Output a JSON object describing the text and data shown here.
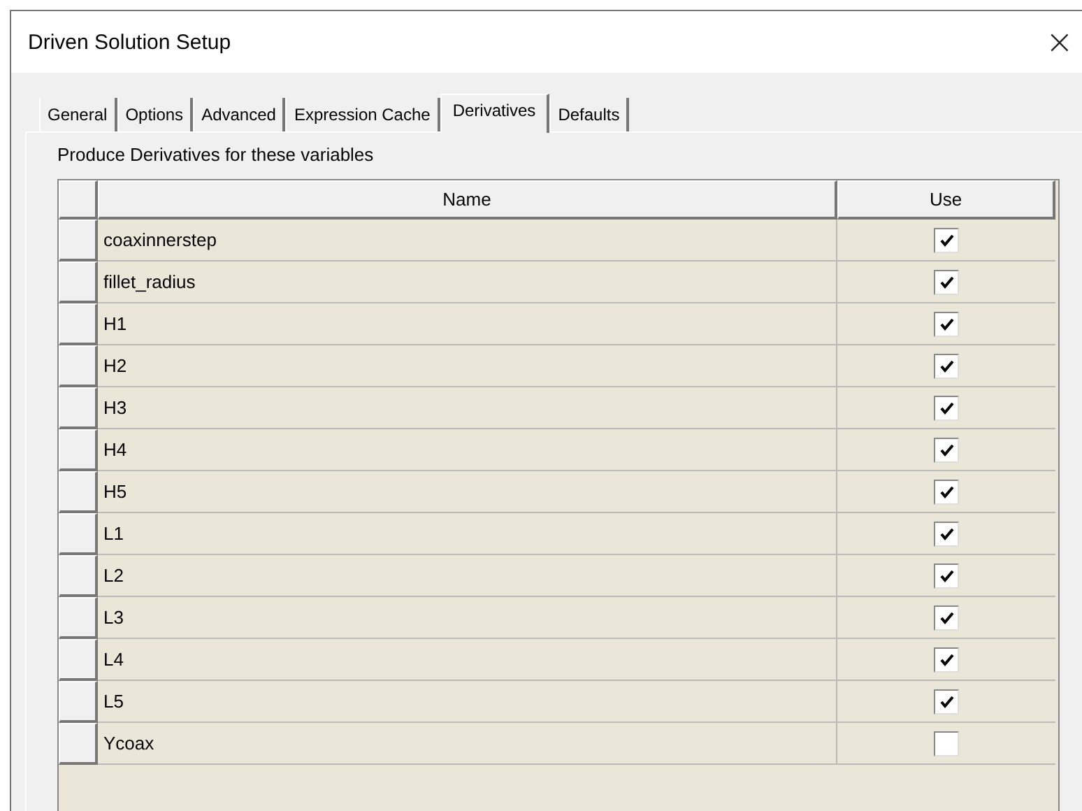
{
  "window": {
    "title": "Driven Solution Setup",
    "close": "×"
  },
  "tabs": [
    {
      "label": "General",
      "selected": false
    },
    {
      "label": "Options",
      "selected": false
    },
    {
      "label": "Advanced",
      "selected": false
    },
    {
      "label": "Expression Cache",
      "selected": false
    },
    {
      "label": "Derivatives",
      "selected": true
    },
    {
      "label": "Defaults",
      "selected": false
    }
  ],
  "caption": "Produce Derivatives for these variables",
  "table": {
    "columns": [
      "Name",
      "Use"
    ],
    "rows": [
      {
        "name": "coaxinnerstep",
        "checked": true
      },
      {
        "name": "fillet_radius",
        "checked": true
      },
      {
        "name": "H1",
        "checked": true
      },
      {
        "name": "H2",
        "checked": true
      },
      {
        "name": "H3",
        "checked": true
      },
      {
        "name": "H4",
        "checked": true
      },
      {
        "name": "H5",
        "checked": true
      },
      {
        "name": "L1",
        "checked": true
      },
      {
        "name": "L2",
        "checked": true
      },
      {
        "name": "L3",
        "checked": true
      },
      {
        "name": "L4",
        "checked": true
      },
      {
        "name": "L5",
        "checked": true
      },
      {
        "name": "Ycoax",
        "checked": false
      }
    ]
  }
}
